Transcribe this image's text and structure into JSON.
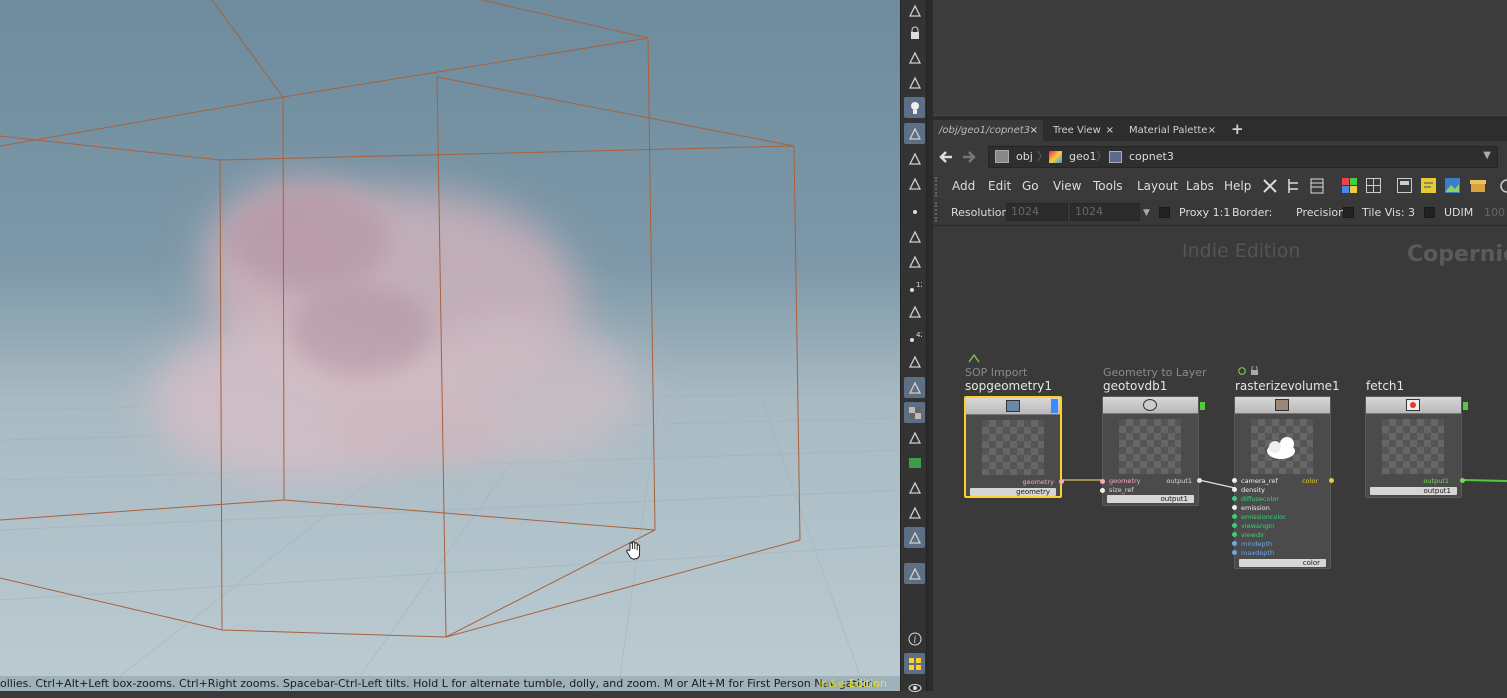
{
  "viewport": {
    "status_text": "ollies. Ctrl+Alt+Left box-zooms. Ctrl+Right zooms. Spacebar-Ctrl-Left tilts. Hold L for alternate tumble, dolly, and zoom. M or Alt+M for First Person Navigation.",
    "indie_label": "Indie Edition",
    "cursor_icon": "hand-cursor-icon"
  },
  "toolbar": {
    "icons": [
      "pose-icon",
      "lock-icon",
      "ghost-icon",
      "snap-icon",
      "light-icon",
      "camera-icon",
      "rotate-icon",
      "layers-icon",
      "point-icon",
      "pick-icon",
      "brush-icon",
      "number-12-icon",
      "paint-icon",
      "number-42-icon",
      "curve-icon",
      "fill-icon",
      "checker-icon",
      "dropper-icon",
      "texture-icon",
      "transform-icon",
      "display-icon",
      "background-icon",
      "pin-icon",
      "info-icon",
      "grid-icon",
      "eye-icon"
    ]
  },
  "tabs": [
    {
      "label": "/obj/geo1/copnet3"
    },
    {
      "label": "Tree View"
    },
    {
      "label": "Material Palette"
    }
  ],
  "tab_add": "+",
  "path": {
    "crumbs": [
      "obj",
      "geo1",
      "copnet3"
    ]
  },
  "menu": [
    "Add",
    "Edit",
    "Go",
    "View",
    "Tools",
    "Layout",
    "Labs",
    "Help"
  ],
  "options": {
    "resolution_label": "Resolution",
    "res_x": "1024",
    "res_y": "1024",
    "proxy_label": "Proxy 1:1",
    "border_label": "Border:",
    "precision_label": "Precision:",
    "tilevis_label": "Tile Vis: 3",
    "udim_label": "UDIM",
    "udim_value": "100"
  },
  "network": {
    "watermark_indie": "Indie Edition",
    "watermark_context": "Copernicus",
    "nodes": [
      {
        "category": "SOP Import",
        "name": "sopgeometry1",
        "out_label": "geometry",
        "inputs": [],
        "footer": "geometry"
      },
      {
        "category": "Geometry to Layer",
        "name": "geotovdb1",
        "out_label": "output1",
        "inputs": [
          "geometry",
          "size_ref"
        ],
        "footer": "output1"
      },
      {
        "category": "",
        "name": "rasterizevolume1",
        "out_label": "color",
        "inputs": [
          "camera_ref",
          "density",
          "diffusecolor",
          "emission",
          "emissioncolor",
          "viewangin",
          "viewdir",
          "mindepth",
          "maxdepth"
        ],
        "footer": "color"
      },
      {
        "category": "",
        "name": "fetch1",
        "out_label": "output1",
        "inputs": [],
        "footer": "output1"
      }
    ]
  },
  "colors": {
    "selected_outline": "#ffd02a",
    "wire_yellow": "#e0c060",
    "wire_green": "#55c840"
  }
}
